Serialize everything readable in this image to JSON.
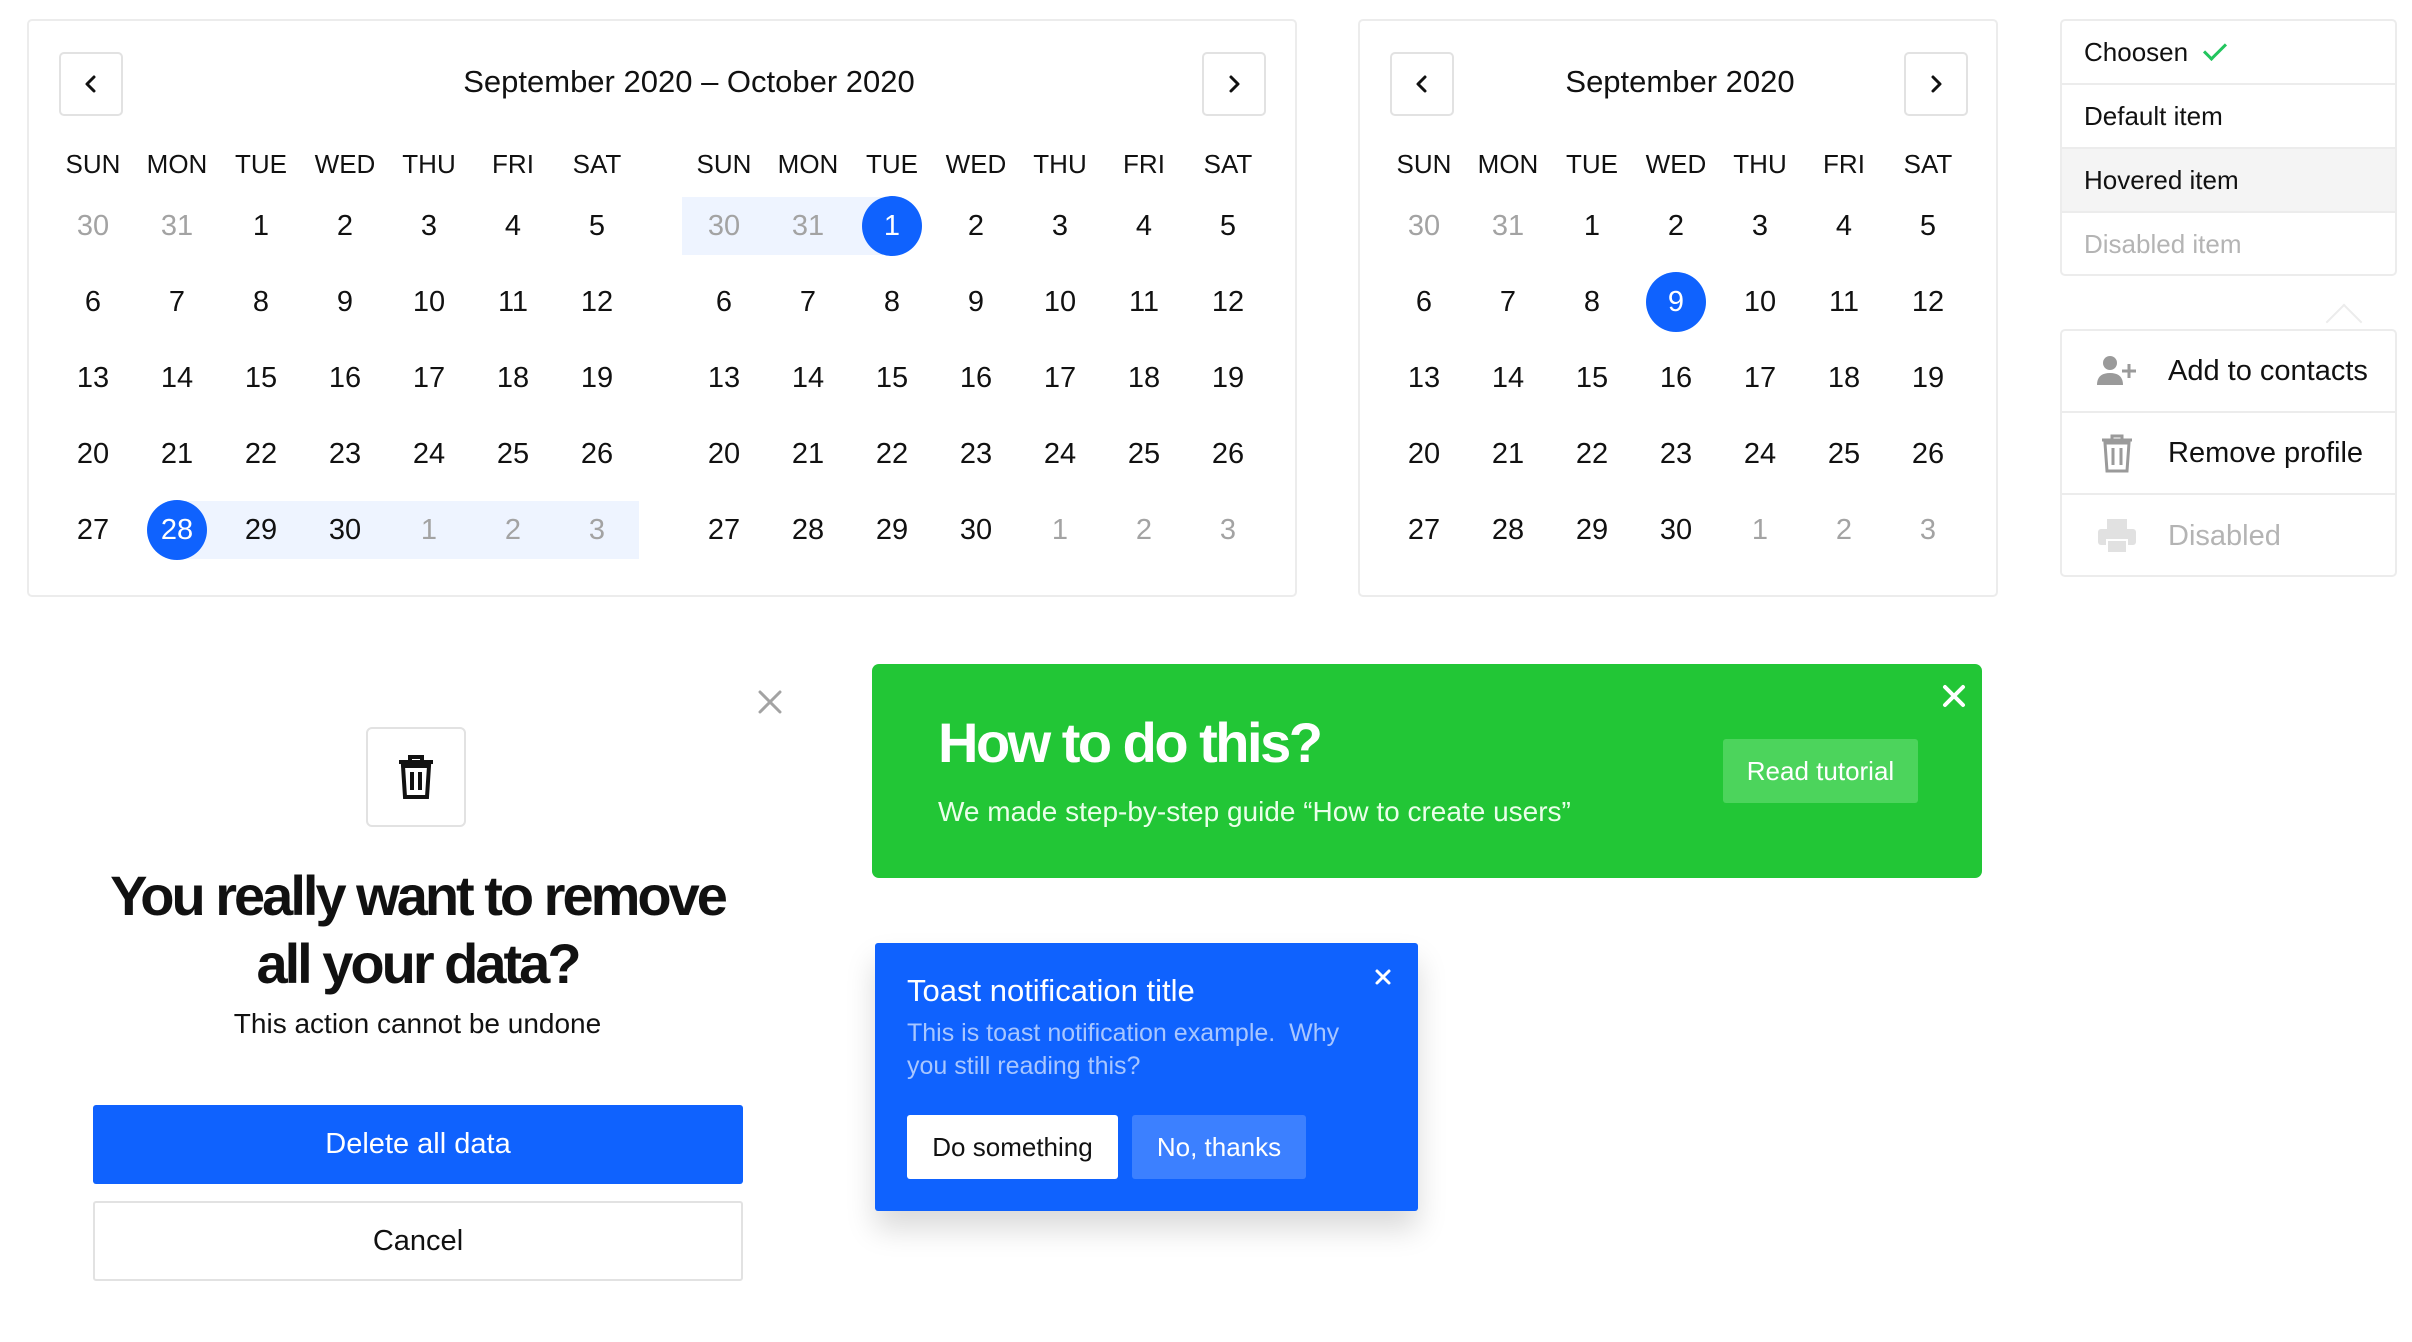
{
  "range_calendar": {
    "title": "September 2020 – October 2020",
    "weekdays": [
      "SUN",
      "MON",
      "TUE",
      "WED",
      "THU",
      "FRI",
      "SAT"
    ],
    "left_month": {
      "weeks": [
        [
          {
            "d": "30",
            "out": true
          },
          {
            "d": "31",
            "out": true
          },
          {
            "d": "1"
          },
          {
            "d": "2"
          },
          {
            "d": "3"
          },
          {
            "d": "4"
          },
          {
            "d": "5"
          }
        ],
        [
          {
            "d": "6"
          },
          {
            "d": "7"
          },
          {
            "d": "8"
          },
          {
            "d": "9"
          },
          {
            "d": "10"
          },
          {
            "d": "11"
          },
          {
            "d": "12"
          }
        ],
        [
          {
            "d": "13"
          },
          {
            "d": "14"
          },
          {
            "d": "15"
          },
          {
            "d": "16"
          },
          {
            "d": "17"
          },
          {
            "d": "18"
          },
          {
            "d": "19"
          }
        ],
        [
          {
            "d": "20"
          },
          {
            "d": "21"
          },
          {
            "d": "22"
          },
          {
            "d": "23"
          },
          {
            "d": "24"
          },
          {
            "d": "25"
          },
          {
            "d": "26"
          }
        ],
        [
          {
            "d": "27"
          },
          {
            "d": "28",
            "sel": true
          },
          {
            "d": "29",
            "range": true
          },
          {
            "d": "30",
            "range": true
          },
          {
            "d": "1",
            "out": true,
            "range": true
          },
          {
            "d": "2",
            "out": true,
            "range": true
          },
          {
            "d": "3",
            "out": true,
            "range": true
          }
        ]
      ]
    },
    "right_month": {
      "weeks": [
        [
          {
            "d": "30",
            "out": true,
            "range": true
          },
          {
            "d": "31",
            "out": true,
            "range": true
          },
          {
            "d": "1",
            "sel": true
          },
          {
            "d": "2"
          },
          {
            "d": "3"
          },
          {
            "d": "4"
          },
          {
            "d": "5"
          }
        ],
        [
          {
            "d": "6"
          },
          {
            "d": "7"
          },
          {
            "d": "8"
          },
          {
            "d": "9"
          },
          {
            "d": "10"
          },
          {
            "d": "11"
          },
          {
            "d": "12"
          }
        ],
        [
          {
            "d": "13"
          },
          {
            "d": "14"
          },
          {
            "d": "15"
          },
          {
            "d": "16"
          },
          {
            "d": "17"
          },
          {
            "d": "18"
          },
          {
            "d": "19"
          }
        ],
        [
          {
            "d": "20"
          },
          {
            "d": "21"
          },
          {
            "d": "22"
          },
          {
            "d": "23"
          },
          {
            "d": "24"
          },
          {
            "d": "25"
          },
          {
            "d": "26"
          }
        ],
        [
          {
            "d": "27"
          },
          {
            "d": "28"
          },
          {
            "d": "29"
          },
          {
            "d": "30"
          },
          {
            "d": "1",
            "out": true
          },
          {
            "d": "2",
            "out": true
          },
          {
            "d": "3",
            "out": true
          }
        ]
      ]
    }
  },
  "single_calendar": {
    "title": "September 2020",
    "weekdays": [
      "SUN",
      "MON",
      "TUE",
      "WED",
      "THU",
      "FRI",
      "SAT"
    ],
    "weeks": [
      [
        {
          "d": "30",
          "out": true
        },
        {
          "d": "31",
          "out": true
        },
        {
          "d": "1"
        },
        {
          "d": "2"
        },
        {
          "d": "3"
        },
        {
          "d": "4"
        },
        {
          "d": "5"
        }
      ],
      [
        {
          "d": "6"
        },
        {
          "d": "7"
        },
        {
          "d": "8"
        },
        {
          "d": "9",
          "sel": true
        },
        {
          "d": "10"
        },
        {
          "d": "11"
        },
        {
          "d": "12"
        }
      ],
      [
        {
          "d": "13"
        },
        {
          "d": "14"
        },
        {
          "d": "15"
        },
        {
          "d": "16"
        },
        {
          "d": "17"
        },
        {
          "d": "18"
        },
        {
          "d": "19"
        }
      ],
      [
        {
          "d": "20"
        },
        {
          "d": "21"
        },
        {
          "d": "22"
        },
        {
          "d": "23"
        },
        {
          "d": "24"
        },
        {
          "d": "25"
        },
        {
          "d": "26"
        }
      ],
      [
        {
          "d": "27"
        },
        {
          "d": "28"
        },
        {
          "d": "29"
        },
        {
          "d": "30"
        },
        {
          "d": "1",
          "out": true
        },
        {
          "d": "2",
          "out": true
        },
        {
          "d": "3",
          "out": true
        }
      ]
    ]
  },
  "select_list": {
    "items": [
      {
        "label": "Choosen",
        "state": "selected"
      },
      {
        "label": "Default item",
        "state": "default"
      },
      {
        "label": "Hovered item",
        "state": "hovered"
      },
      {
        "label": "Disabled item",
        "state": "disabled"
      }
    ]
  },
  "context_menu": {
    "items": [
      {
        "label": "Add to contacts",
        "icon": "add-user-icon",
        "disabled": false
      },
      {
        "label": "Remove profile",
        "icon": "trash-icon",
        "disabled": false
      },
      {
        "label": "Disabled",
        "icon": "printer-icon",
        "disabled": true
      }
    ]
  },
  "confirm_dialog": {
    "title_line1": "You really want to remove",
    "title_line2": "all your data?",
    "subtitle": "This action cannot be undone",
    "confirm_label": "Delete all data",
    "cancel_label": "Cancel"
  },
  "banner": {
    "title": "How to do this?",
    "text": "We made step-by-step guide “How to create users”",
    "action_label": "Read tutorial",
    "color": "#22c636"
  },
  "toast": {
    "title": "Toast notification title",
    "body": "This is toast notification example.  Why you still reading this?",
    "primary_label": "Do something",
    "secondary_label": "No, thanks",
    "color": "#0f62fe"
  },
  "colors": {
    "accent": "#0f62fe",
    "range_bg": "#eef4ff",
    "success": "#22c636",
    "muted_text": "#a3a3a3"
  }
}
